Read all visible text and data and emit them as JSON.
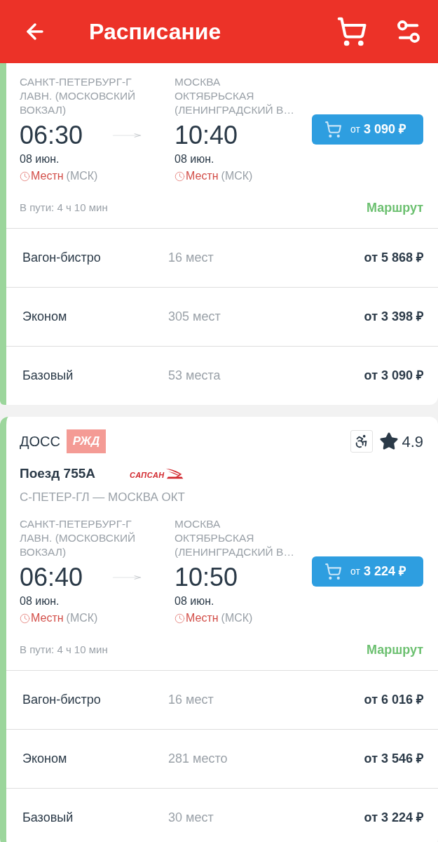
{
  "app_bar": {
    "title": "Расписание"
  },
  "trains": [
    {
      "departure": {
        "station": "САНКТ-ПЕТЕРБУРГ-Г\nЛАВН. (МОСКОВСКИЙ\nВОКЗАЛ)",
        "time": "06:30",
        "date": "08 июн.",
        "tz_label": "Местн",
        "tz": "(МСК)"
      },
      "arrival": {
        "station": "МОСКВА\nОКТЯБРЬСКАЯ\n(ЛЕНИНГРАДСКИЙ В…",
        "time": "10:40",
        "date": "08 июн.",
        "tz_label": "Местн",
        "tz": "(МСК)"
      },
      "buy_button": {
        "prefix": "от",
        "price": "3 090 ₽"
      },
      "duration": "В пути: 4 ч 10 мин",
      "route_link": "Маршрут",
      "classes": [
        {
          "name": "Вагон-бистро",
          "seats": "16 мест",
          "price": "от 5 868 ₽"
        },
        {
          "name": "Эконом",
          "seats": "305 мест",
          "price": "от 3 398 ₽"
        },
        {
          "name": "Базовый",
          "seats": "53 места",
          "price": "от 3 090 ₽"
        }
      ]
    },
    {
      "carrier": "ДОСС",
      "carrier_logo": "РЖД",
      "accessible": true,
      "rating": "4.9",
      "train": "Поезд 755А",
      "brand": "САПСАН",
      "route": "С-ПЕТЕР-ГЛ — МОСКВА ОКТ",
      "departure": {
        "station": "САНКТ-ПЕТЕРБУРГ-Г\nЛАВН. (МОСКОВСКИЙ\nВОКЗАЛ)",
        "time": "06:40",
        "date": "08 июн.",
        "tz_label": "Местн",
        "tz": "(МСК)"
      },
      "arrival": {
        "station": "МОСКВА\nОКТЯБРЬСКАЯ\n(ЛЕНИНГРАДСКИЙ В…",
        "time": "10:50",
        "date": "08 июн.",
        "tz_label": "Местн",
        "tz": "(МСК)"
      },
      "buy_button": {
        "prefix": "от",
        "price": "3 224 ₽"
      },
      "duration": "В пути: 4 ч 10 мин",
      "route_link": "Маршрут",
      "classes": [
        {
          "name": "Вагон-бистро",
          "seats": "16 мест",
          "price": "от 6 016 ₽"
        },
        {
          "name": "Эконом",
          "seats": "281 место",
          "price": "от 3 546 ₽"
        },
        {
          "name": "Базовый",
          "seats": "30 мест",
          "price": "от 3 224 ₽"
        }
      ]
    }
  ]
}
